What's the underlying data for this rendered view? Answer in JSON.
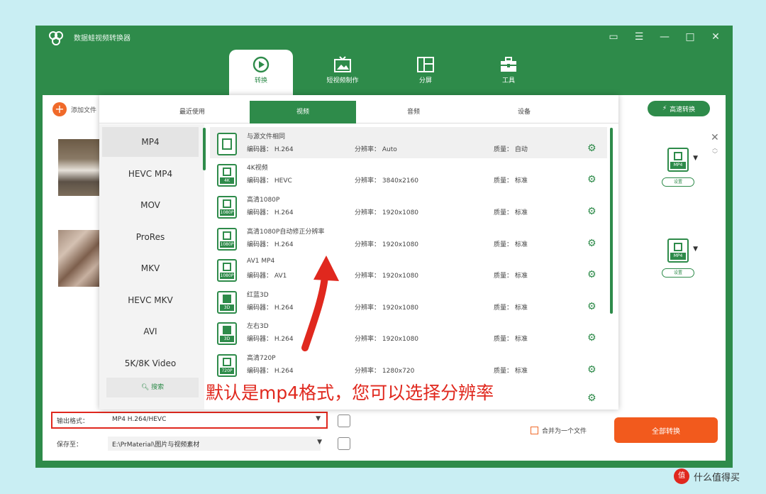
{
  "app": {
    "title": "数据蛙视频转换器"
  },
  "nav_tabs": [
    {
      "label": "转换"
    },
    {
      "label": "短视频制作"
    },
    {
      "label": "分屏"
    },
    {
      "label": "工具"
    }
  ],
  "toolbar": {
    "add_file_label": "添加文件",
    "turbo_label": "高速转换"
  },
  "rows": [
    {
      "format_badge": "MP4",
      "edit_label": "设置"
    },
    {
      "format_badge": "MP4",
      "edit_label": "设置"
    }
  ],
  "dropdown": {
    "tabs": [
      "最近使用",
      "视频",
      "音频",
      "设备"
    ],
    "formats": [
      "MP4",
      "HEVC MP4",
      "MOV",
      "ProRes",
      "MKV",
      "HEVC MKV",
      "AVI",
      "5K/8K Video"
    ],
    "search_label": "搜索",
    "presets": [
      {
        "name": "与源文件相同",
        "badge": "",
        "encoder_label": "编码器：",
        "encoder": "H.264",
        "res_label": "分辨率：",
        "resolution": "Auto",
        "quality_label": "质量：",
        "quality": "自动"
      },
      {
        "name": "4K视频",
        "badge": "4K",
        "encoder_label": "编码器：",
        "encoder": "HEVC",
        "res_label": "分辨率：",
        "resolution": "3840x2160",
        "quality_label": "质量：",
        "quality": "标准"
      },
      {
        "name": "高清1080P",
        "badge": "1080P",
        "encoder_label": "编码器：",
        "encoder": "H.264",
        "res_label": "分辨率：",
        "resolution": "1920x1080",
        "quality_label": "质量：",
        "quality": "标准"
      },
      {
        "name": "高清1080P自动修正分辨率",
        "badge": "1080P",
        "encoder_label": "编码器：",
        "encoder": "H.264",
        "res_label": "分辨率：",
        "resolution": "1920x1080",
        "quality_label": "质量：",
        "quality": "标准"
      },
      {
        "name": "AV1 MP4",
        "badge": "1080P",
        "encoder_label": "编码器：",
        "encoder": "AV1",
        "res_label": "分辨率：",
        "resolution": "1920x1080",
        "quality_label": "质量：",
        "quality": "标准"
      },
      {
        "name": "红蓝3D",
        "badge": "3D",
        "encoder_label": "编码器：",
        "encoder": "H.264",
        "res_label": "分辨率：",
        "resolution": "1920x1080",
        "quality_label": "质量：",
        "quality": "标准"
      },
      {
        "name": "左右3D",
        "badge": "3D",
        "encoder_label": "编码器：",
        "encoder": "H.264",
        "res_label": "分辨率：",
        "resolution": "1920x1080",
        "quality_label": "质量：",
        "quality": "标准"
      },
      {
        "name": "高清720P",
        "badge": "720P",
        "encoder_label": "编码器：",
        "encoder": "H.264",
        "res_label": "分辨率：",
        "resolution": "1280x720",
        "quality_label": "质量：",
        "quality": "标准"
      }
    ]
  },
  "output": {
    "format_label": "输出格式：",
    "format_value": "MP4 H.264/HEVC",
    "save_label": "保存至：",
    "save_value": "E:\\PrMaterial\\图片与视频素材",
    "merge_label": "合并为一个文件",
    "convert_all_label": "全部转换"
  },
  "annotation": "默认是mp4格式，您可以选择分辨率",
  "watermark": {
    "logo": "值",
    "text": "什么值得买"
  },
  "colors": {
    "brand_green": "#2e8b4a",
    "accent_orange": "#f25a1d",
    "annotation_red": "#e0281e"
  }
}
